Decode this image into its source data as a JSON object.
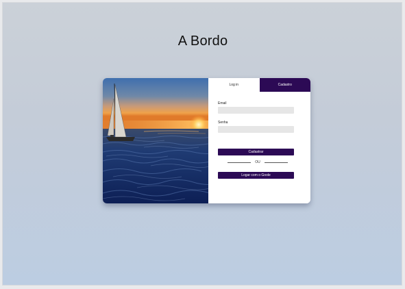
{
  "header": {
    "title": "A Bordo"
  },
  "auth": {
    "tabs": [
      {
        "label": "Log in",
        "active": true
      },
      {
        "label": "Cadastro",
        "active": false
      }
    ],
    "email_label": "Email",
    "email_value": "",
    "password_label": "Senha",
    "password_value": "",
    "submit_label": "Cadastrar",
    "divider_text": "OU",
    "google_label": "Logar com o Goole"
  },
  "image": {
    "subject": "sailboat-at-sunset"
  },
  "colors": {
    "accent": "#2c0a55",
    "field_bg": "#e6e6e6",
    "page_bg_top": "#cbd1d8",
    "page_bg_bottom": "#bccde2"
  }
}
